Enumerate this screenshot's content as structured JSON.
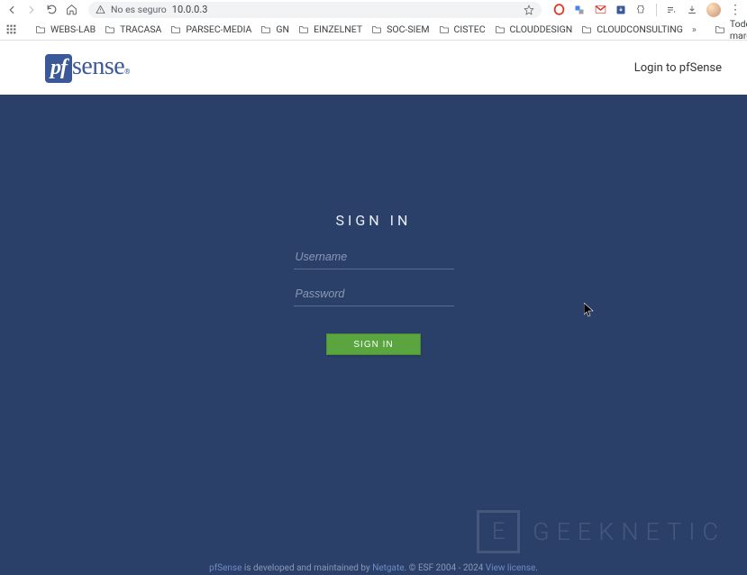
{
  "browser": {
    "url": "10.0.0.3",
    "security_label": "No es seguro"
  },
  "bookmarks": {
    "items": [
      "WEBS-LAB",
      "TRACASA",
      "PARSEC-MEDIA",
      "GN",
      "EINZELNET",
      "SOC-SIEM",
      "CISTEC",
      "CLOUDDESIGN",
      "CLOUDCONSULTING"
    ],
    "overflow": "»",
    "all_label": "Todos los marcadores"
  },
  "header": {
    "logo_prefix": "pf",
    "logo_suffix": "sense",
    "right_label": "Login to pfSense"
  },
  "login": {
    "title": "SIGN IN",
    "username_placeholder": "Username",
    "password_placeholder": "Password",
    "submit_label": "SIGN IN"
  },
  "watermark": {
    "box": "E",
    "text": "GEEKNETIC"
  },
  "footer": {
    "link1": "pfSense",
    "text1": " is developed and maintained by ",
    "link2": "Netgate",
    "text2": ". © ESF 2004 - 2024 ",
    "link3": "View license",
    "text3": "."
  }
}
